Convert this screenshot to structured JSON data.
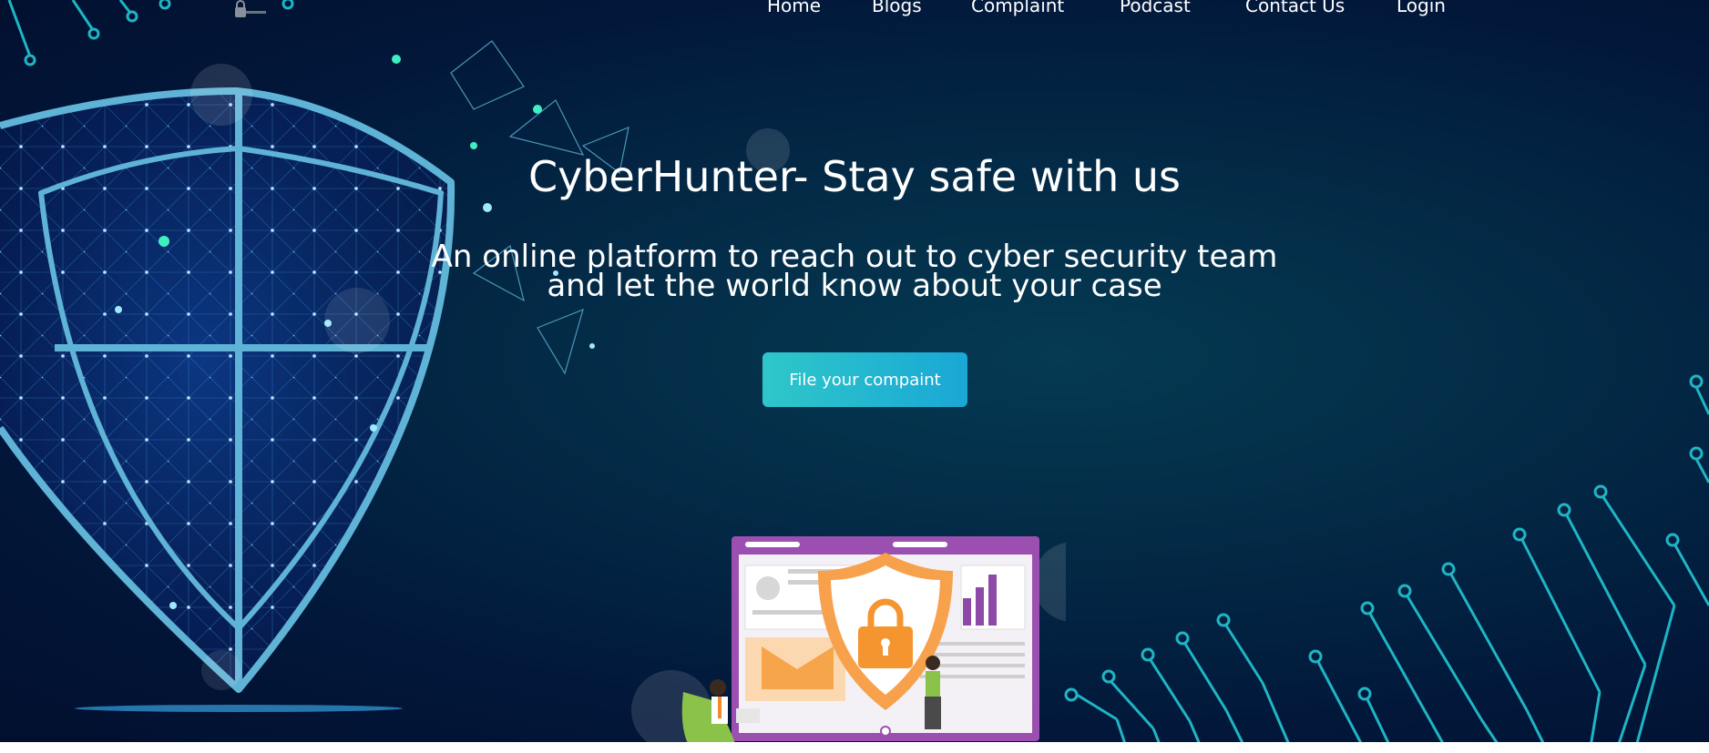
{
  "nav": {
    "items": [
      {
        "label": "Home"
      },
      {
        "label": "Blogs"
      },
      {
        "label": "Complaint"
      },
      {
        "label": "Podcast"
      },
      {
        "label": "Contact Us"
      },
      {
        "label": "Login"
      }
    ]
  },
  "hero": {
    "title": "CyberHunter- Stay safe with us",
    "subtitle_line1": "An online platform to reach out to cyber security team",
    "subtitle_line2": "and let the world know about your case",
    "cta_label": "File your compaint"
  },
  "colors": {
    "background": "#031f3d",
    "accent": "#2ec7c9",
    "circuit": "#1fb5c4",
    "shield": "#5fb3d6"
  },
  "icons": {
    "logo": "lock-icon",
    "left_art": "digital-shield-illustration",
    "bottom_art": "security-monitor-illustration",
    "circuits": "circuit-lines-decoration"
  }
}
